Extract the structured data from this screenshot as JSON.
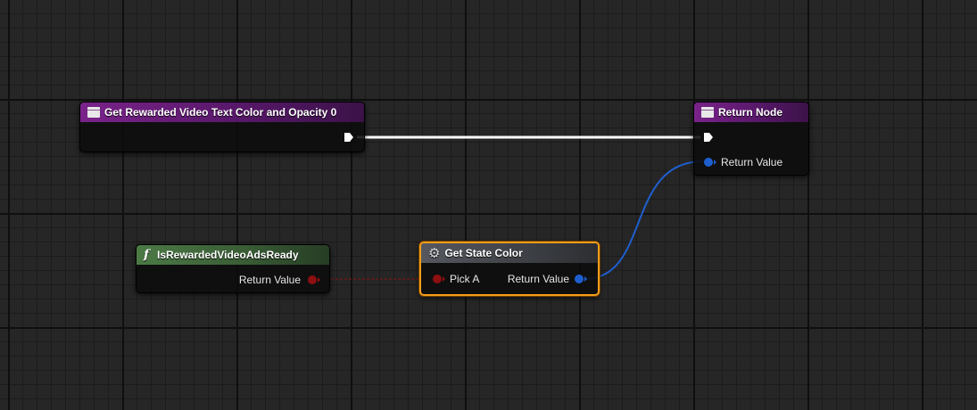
{
  "nodes": {
    "entry": {
      "title": "Get Rewarded Video Text Color and Opacity 0",
      "icon": "function-entry-icon",
      "header_color": "#7a238a"
    },
    "return_node": {
      "title": "Return Node",
      "icon": "function-return-icon",
      "header_color": "#7a238a",
      "return_value_label": "Return Value"
    },
    "is_ready": {
      "title": "IsRewardedVideoAdsReady",
      "icon": "function-icon",
      "icon_glyph": "f",
      "header_color": "#4b7a45",
      "return_value_label": "Return Value"
    },
    "get_state_color": {
      "title": "Get State Color",
      "icon": "gear-icon",
      "icon_glyph": "⚙",
      "header_color": "#55585e",
      "pick_a_label": "Pick A",
      "return_value_label": "Return Value",
      "selected": true
    }
  },
  "colors": {
    "exec_wire": "#ffffff",
    "bool_pin": "#8e0f0f",
    "struct_pin": "#1e5fd0",
    "selection": "#f59d1a"
  }
}
